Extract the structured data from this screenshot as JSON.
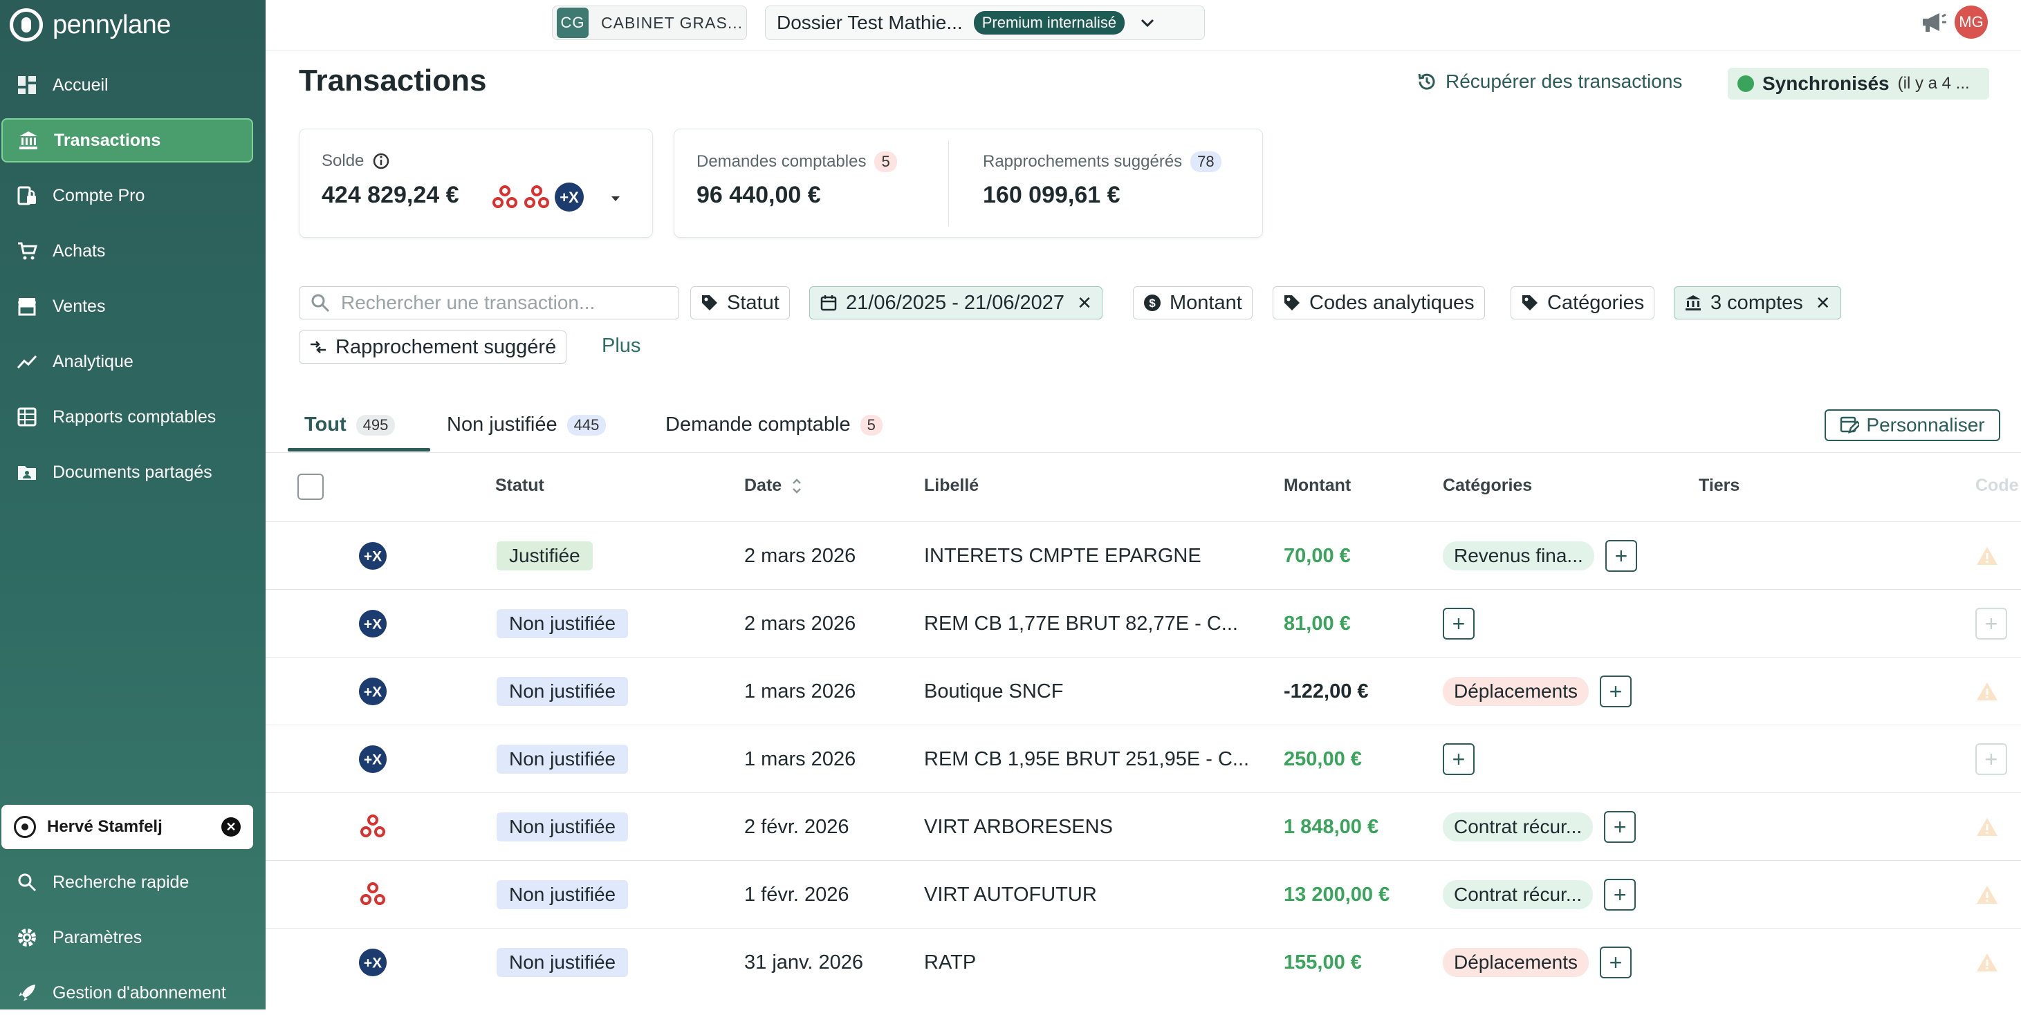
{
  "brand": {
    "name": "pennylane"
  },
  "sidebar": {
    "items": [
      {
        "label": "Accueil",
        "icon": "dashboard-icon",
        "active": false
      },
      {
        "label": "Transactions",
        "icon": "bank-icon",
        "active": true
      },
      {
        "label": "Compte Pro",
        "icon": "card-lock-icon",
        "active": false
      },
      {
        "label": "Achats",
        "icon": "cart-icon",
        "active": false
      },
      {
        "label": "Ventes",
        "icon": "store-icon",
        "active": false
      },
      {
        "label": "Analytique",
        "icon": "trend-icon",
        "active": false
      },
      {
        "label": "Rapports comptables",
        "icon": "report-icon",
        "active": false
      },
      {
        "label": "Documents partagés",
        "icon": "folder-share-icon",
        "active": false
      }
    ],
    "user": {
      "name": "Hervé Stamfelj"
    },
    "bottom": [
      {
        "label": "Recherche rapide",
        "icon": "search-icon"
      },
      {
        "label": "Paramètres",
        "icon": "gear-icon"
      },
      {
        "label": "Gestion d'abonnement",
        "icon": "rocket-icon"
      }
    ]
  },
  "topbar": {
    "cabinet_initials": "CG",
    "cabinet_name": "CABINET GRAS...",
    "dossier_name": "Dossier Test Mathie...",
    "dossier_badge": "Premium internalisé",
    "avatar_initials": "MG"
  },
  "page": {
    "title": "Transactions",
    "recuperer_label": "Récupérer des transactions",
    "sync_label": "Synchronisés",
    "sync_detail": "(il y a 4 ..."
  },
  "cards": {
    "solde": {
      "label": "Solde",
      "value": "424 829,24 €"
    },
    "demandes": {
      "label": "Demandes comptables",
      "count": "5",
      "value": "96 440,00 €"
    },
    "rapprochements": {
      "label": "Rapprochements suggérés",
      "count": "78",
      "value": "160 099,61 €"
    }
  },
  "filters": {
    "search_placeholder": "Rechercher une transaction...",
    "statut": "Statut",
    "date_range": "21/06/2025 - 21/06/2027",
    "montant": "Montant",
    "codes": "Codes analytiques",
    "categories": "Catégories",
    "comptes": "3 comptes",
    "rapprochement": "Rapprochement suggéré",
    "plus": "Plus"
  },
  "tabs": [
    {
      "label": "Tout",
      "count": "495"
    },
    {
      "label": "Non justifiée",
      "count": "445"
    },
    {
      "label": "Demande comptable",
      "count": "5"
    }
  ],
  "personnaliser_label": "Personnaliser",
  "table": {
    "headers": {
      "statut": "Statut",
      "date": "Date",
      "libelle": "Libellé",
      "montant": "Montant",
      "categories": "Catégories",
      "tiers": "Tiers",
      "codes": "Code"
    },
    "rows": [
      {
        "bank": "bank-px",
        "status": "Justifiée",
        "date": "2 mars 2026",
        "libelle": "INTERETS CMPTE EPARGNE",
        "montant": "70,00 €",
        "positive": true,
        "category": "Revenus fina...",
        "cat_color": "green"
      },
      {
        "bank": "bank-px",
        "status": "Non justifiée",
        "date": "2 mars 2026",
        "libelle": "REM CB 1,77E BRUT 82,77E - C...",
        "montant": "81,00 €",
        "positive": true,
        "category": "",
        "cat_color": ""
      },
      {
        "bank": "bank-px",
        "status": "Non justifiée",
        "date": "1 mars 2026",
        "libelle": "Boutique SNCF",
        "montant": "-122,00 €",
        "positive": false,
        "category": "Déplacements",
        "cat_color": "red"
      },
      {
        "bank": "bank-px",
        "status": "Non justifiée",
        "date": "1 mars 2026",
        "libelle": "REM CB 1,95E BRUT 251,95E - C...",
        "montant": "250,00 €",
        "positive": true,
        "category": "",
        "cat_color": ""
      },
      {
        "bank": "bank-tri",
        "status": "Non justifiée",
        "date": "2 févr. 2026",
        "libelle": "VIRT ARBORESENS",
        "montant": "1 848,00 €",
        "positive": true,
        "category": "Contrat récur...",
        "cat_color": "green"
      },
      {
        "bank": "bank-tri",
        "status": "Non justifiée",
        "date": "1 févr. 2026",
        "libelle": "VIRT AUTOFUTUR",
        "montant": "13 200,00 €",
        "positive": true,
        "category": "Contrat récur...",
        "cat_color": "green"
      },
      {
        "bank": "bank-px",
        "status": "Non justifiée",
        "date": "31 janv. 2026",
        "libelle": "RATP",
        "montant": "155,00 €",
        "positive": true,
        "category": "Déplacements",
        "cat_color": "red"
      }
    ]
  },
  "colors": {
    "sidebar": "#2b5c58",
    "accent": "#2b5c58",
    "positive": "#3aa45c",
    "active_nav": "#4a9d6c"
  }
}
